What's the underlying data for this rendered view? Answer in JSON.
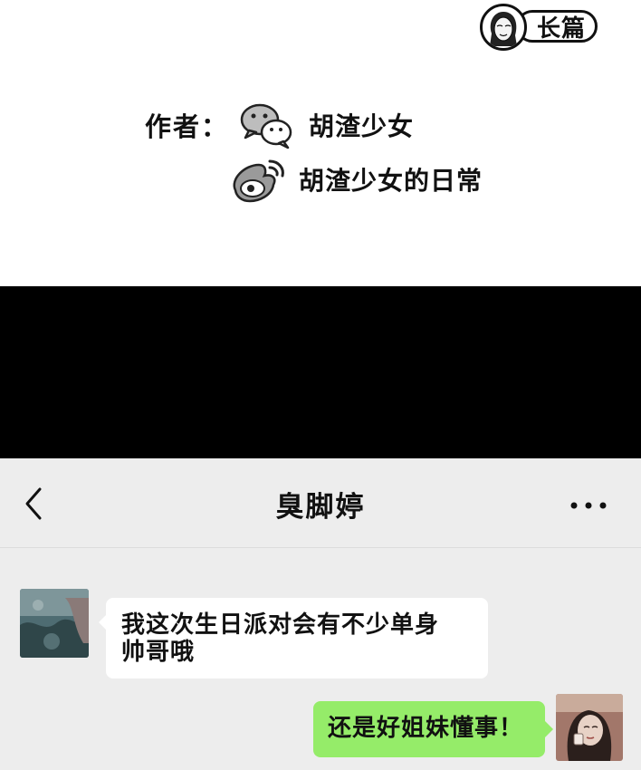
{
  "badge": {
    "label": "长篇"
  },
  "credits": {
    "author_label": "作者：",
    "wechat_name": "胡渣少女",
    "weibo_name": "胡渣少女的日常"
  },
  "chat": {
    "title": "臭脚婷",
    "messages": [
      {
        "side": "left",
        "line1": "我这次生日派对会有不少单身",
        "line2": "帅哥哦"
      },
      {
        "side": "right",
        "text": "还是好姐妹懂事！"
      }
    ]
  },
  "colors": {
    "sent_bubble": "#95ec69",
    "received_bubble": "#ffffff",
    "chat_bg": "#ededed"
  }
}
